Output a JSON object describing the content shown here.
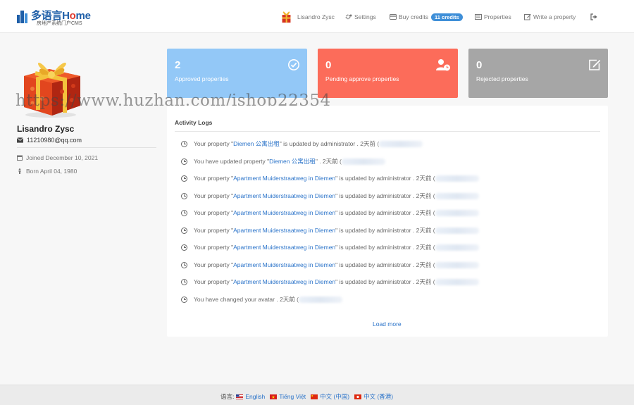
{
  "header": {
    "logo_brand_cn": "多语言",
    "logo_brand_en_1": "H",
    "logo_brand_en_2": "o",
    "logo_brand_en_3": "me",
    "logo_tagline": "房地产系统门户CMS",
    "user_name": "Lisandro Zysc",
    "settings_label": "Settings",
    "buy_credits_label": "Buy credits",
    "credits_badge": "11 credits",
    "properties_label": "Properties",
    "write_property_label": "Write a property"
  },
  "profile": {
    "name": "Lisandro Zysc",
    "email": "11210980@qq.com",
    "joined": "Joined December 10, 2021",
    "born": "Born April 04, 1980"
  },
  "stats": {
    "approved": {
      "count": "2",
      "label": "Approved properties",
      "color": "#93c8f7"
    },
    "pending": {
      "count": "0",
      "label": "Pending approve properties",
      "color": "#fc6c5a"
    },
    "rejected": {
      "count": "0",
      "label": "Rejected properties",
      "color": "#a6a6a6"
    }
  },
  "watermark": "https://www.huzhan.com/ishop22354",
  "activity": {
    "title": "Activity Logs",
    "logs": [
      {
        "pre": "Your property \"",
        "link": "Diemen 公寓出租",
        "post": "\" is updated by administrator . 2天前 ("
      },
      {
        "pre": "You have updated property \"",
        "link": "Diemen 公寓出租",
        "post": "\" . 2天前 ("
      },
      {
        "pre": "Your property \"",
        "link": "Apartment Muiderstraatweg in Diemen",
        "post": "\" is updated by administrator . 2天前 ("
      },
      {
        "pre": "Your property \"",
        "link": "Apartment Muiderstraatweg in Diemen",
        "post": "\" is updated by administrator . 2天前 ("
      },
      {
        "pre": "Your property \"",
        "link": "Apartment Muiderstraatweg in Diemen",
        "post": "\" is updated by administrator . 2天前 ("
      },
      {
        "pre": "Your property \"",
        "link": "Apartment Muiderstraatweg in Diemen",
        "post": "\" is updated by administrator . 2天前 ("
      },
      {
        "pre": "Your property \"",
        "link": "Apartment Muiderstraatweg in Diemen",
        "post": "\" is updated by administrator . 2天前 ("
      },
      {
        "pre": "Your property \"",
        "link": "Apartment Muiderstraatweg in Diemen",
        "post": "\" is updated by administrator . 2天前 ("
      },
      {
        "pre": "Your property \"",
        "link": "Apartment Muiderstraatweg in Diemen",
        "post": "\" is updated by administrator . 2天前 ("
      },
      {
        "pre": "You have changed your avatar . 2天前 (",
        "link": "",
        "post": ""
      }
    ],
    "load_more": "Load more"
  },
  "footer": {
    "language_label": "语言:",
    "languages": [
      "English",
      "Tiếng Việt",
      "中文 (中国)",
      "中文 (香港)"
    ]
  }
}
